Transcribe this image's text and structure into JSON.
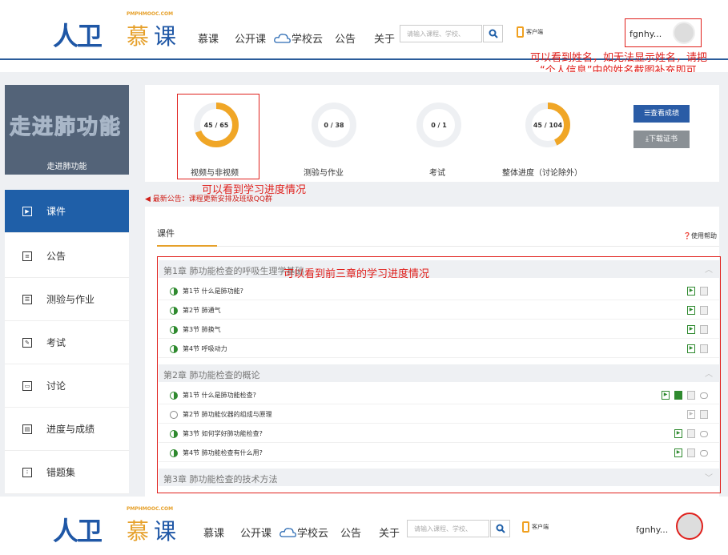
{
  "header": {
    "logo_text": "人卫",
    "logo_mooc_1": "慕",
    "logo_mooc_2": "课",
    "logo_domain": "PMPHMOOC.COM",
    "nav": [
      "慕课",
      "公开课",
      "学校云",
      "公告",
      "关于"
    ],
    "search_placeholder": "请输入课程、学校、",
    "client_label": "客户端",
    "user_name": "fgnhy..."
  },
  "annotations": {
    "name_note_line1": "可以看到姓名，如无法显示姓名，请把",
    "name_note_line2": "“个人信息”中的姓名截图补充即可",
    "progress_note": "可以看到学习进度情况",
    "chapters_note": "可以看到前三章的学习进度情况"
  },
  "course": {
    "title_art": "走进肺功能",
    "name": "走进肺功能"
  },
  "progress": [
    {
      "label": "视频与非视频",
      "text": "45 / 65",
      "done": 45,
      "total": 65
    },
    {
      "label": "测验与作业",
      "text": "0 / 38",
      "done": 0,
      "total": 38
    },
    {
      "label": "考试",
      "text": "0 / 1",
      "done": 0,
      "total": 1
    },
    {
      "label": "整体进度（讨论除外）",
      "text": "45 / 104",
      "done": 45,
      "total": 104
    }
  ],
  "buttons": {
    "view_score": "查看成绩",
    "download_cert": "下载证书"
  },
  "notice": "最新公告：课程更新安排及班级QQ群",
  "sidebar": [
    "课件",
    "公告",
    "测验与作业",
    "考试",
    "讨论",
    "进度与成绩",
    "错题集"
  ],
  "tab_label": "课件",
  "help_label": "使用帮助",
  "chapters": [
    {
      "title": "第1章 肺功能检查的呼吸生理学基础",
      "sections": [
        "第1节 什么是肺功能?",
        "第2节 肺通气",
        "第3节 肺换气",
        "第4节 呼吸动力"
      ]
    },
    {
      "title": "第2章 肺功能检查的概论",
      "sections": [
        "第1节 什么是肺功能检查?",
        "第2节 肺功能仪器的组成与原理",
        "第3节 如何学好肺功能检查?",
        "第4节 肺功能检查有什么用?"
      ]
    },
    {
      "title": "第3章 肺功能检查的技术方法",
      "sections": []
    }
  ],
  "colors": {
    "accent": "#1f5fa8",
    "ring": "#f0a626",
    "annotation": "#e0201c"
  }
}
